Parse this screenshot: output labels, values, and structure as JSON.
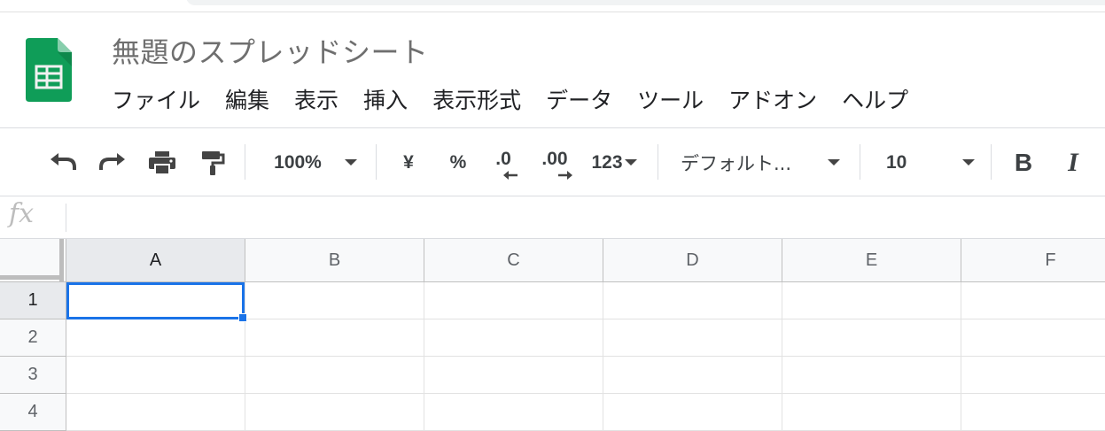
{
  "app": {
    "title": "無題のスプレッドシート",
    "logo_icon": "sheets-logo-icon",
    "brand_color": "#0f9d58"
  },
  "menu": [
    "ファイル",
    "編集",
    "表示",
    "挿入",
    "表示形式",
    "データ",
    "ツール",
    "アドオン",
    "ヘルプ"
  ],
  "toolbar": {
    "undo_icon": "undo-icon",
    "redo_icon": "redo-icon",
    "print_icon": "print-icon",
    "paint_format_icon": "paint-format-icon",
    "zoom": "100%",
    "currency": "¥",
    "percent": "%",
    "decrease_decimal": ".0",
    "increase_decimal": ".00",
    "more_formats": "123",
    "font": "デフォルト...",
    "font_size": "10",
    "bold": "B",
    "italic": "I"
  },
  "formula_bar": {
    "fx_label": "fx",
    "value": ""
  },
  "grid": {
    "columns": [
      "A",
      "B",
      "C",
      "D",
      "E",
      "F"
    ],
    "rows": [
      "1",
      "2",
      "3",
      "4"
    ],
    "selected_cell": "A1",
    "selection_color": "#1a73e8"
  }
}
